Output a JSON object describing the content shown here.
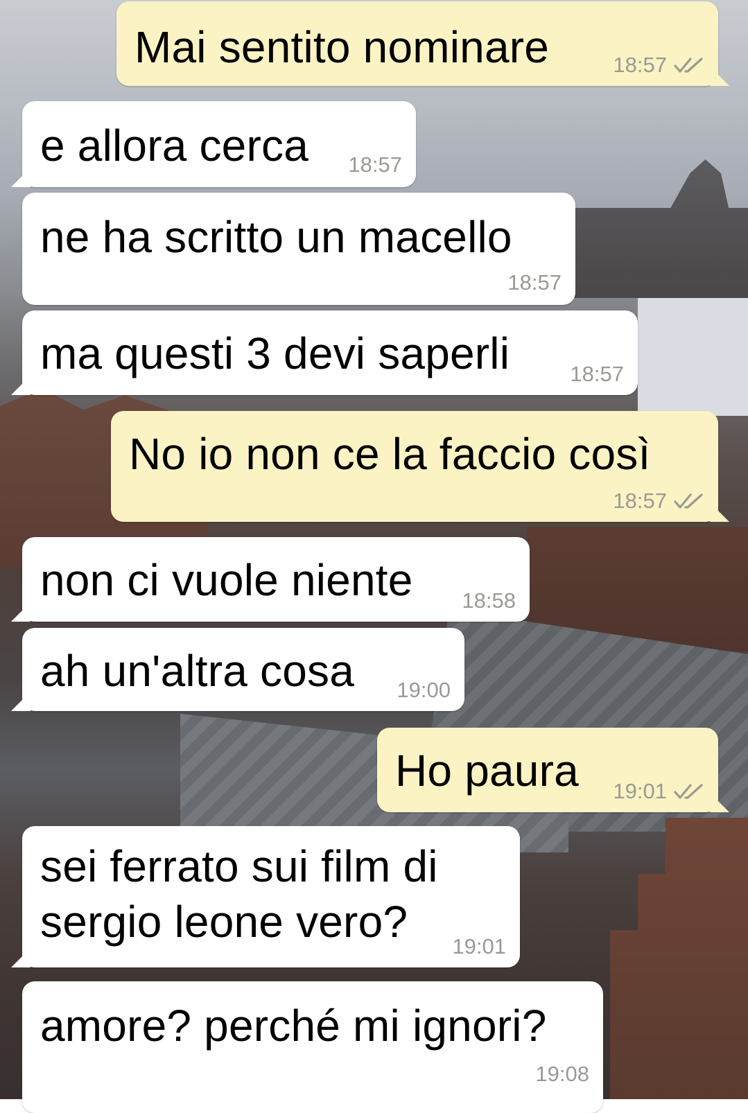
{
  "messages": [
    {
      "side": "out",
      "text": "Mai sentito nominare",
      "time": "18:57",
      "status": "read"
    },
    {
      "side": "in",
      "text": "e allora cerca",
      "time": "18:57"
    },
    {
      "side": "in",
      "text": "ne ha scritto un macello",
      "time": "18:57"
    },
    {
      "side": "in",
      "text": "ma questi 3 devi saperli",
      "time": "18:57"
    },
    {
      "side": "out",
      "text": "No io non ce la faccio così",
      "time": "18:57",
      "status": "read"
    },
    {
      "side": "in",
      "text": "non ci vuole niente",
      "time": "18:58"
    },
    {
      "side": "in",
      "text": "ah un'altra cosa",
      "time": "19:00"
    },
    {
      "side": "out",
      "text": "Ho paura",
      "time": "19:01",
      "status": "read"
    },
    {
      "side": "in",
      "text": "sei ferrato sui film di\nsergio leone vero?",
      "time": "19:01"
    },
    {
      "side": "in",
      "text": "amore? perché mi ignori?",
      "time": "19:08"
    }
  ],
  "colors": {
    "incoming_bubble": "#ffffff",
    "outgoing_bubble": "#fbf3c3",
    "timestamp": "#9a9a94",
    "read_ticks": "#9a9a94"
  },
  "icons": {
    "read_status": "double-check-icon"
  }
}
